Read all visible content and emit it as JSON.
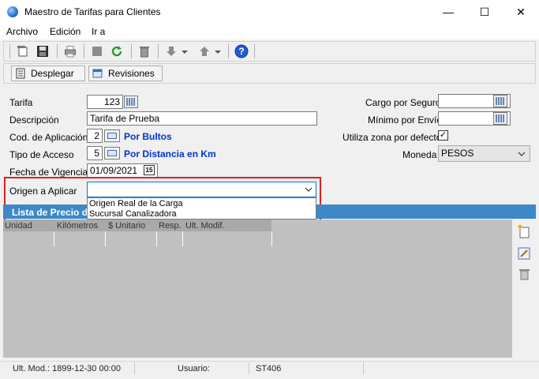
{
  "window": {
    "title": "Maestro de Tarifas para Clientes",
    "minimize": "—",
    "maximize": "☐",
    "close": "✕"
  },
  "menu": [
    "Archivo",
    "Edición",
    "Ir a"
  ],
  "buttons": {
    "desplegar": "Desplegar",
    "revisiones": "Revisiones"
  },
  "form": {
    "tarifa": {
      "label": "Tarifa",
      "value": "123"
    },
    "descripcion": {
      "label": "Descripción",
      "value": "Tarifa de Prueba"
    },
    "cod_aplicacion": {
      "label": "Cod. de Aplicación",
      "value": "2",
      "desc": "Por Bultos"
    },
    "tipo_acceso": {
      "label": "Tipo de Acceso",
      "value": "5",
      "desc": "Por Distancia en Km"
    },
    "fecha_vigencia": {
      "label": "Fecha de Vigencia",
      "value": "01/09/2021",
      "calendar_glyph": "15"
    },
    "origen": {
      "label": "Origen a Aplicar",
      "value": "",
      "options": [
        "Origen Real de la Carga",
        "Sucursal Canalizadora"
      ]
    },
    "cargo_seguro": {
      "label": "Cargo por Seguro",
      "value": ""
    },
    "minimo_envio": {
      "label": "Mínimo por Envío",
      "value": ""
    },
    "utiliza_zona": {
      "label": "Utiliza zona por defecto",
      "checked": true,
      "check_glyph": "✓"
    },
    "moneda": {
      "label": "Moneda",
      "value": "PESOS"
    }
  },
  "list": {
    "title": "Lista de Precio de",
    "columns": [
      "Unidad",
      "Kilómetros",
      "$ Unitario",
      "Resp.",
      "Ult. Modif."
    ]
  },
  "status": {
    "ult_mod": "Ult. Mod.: 1899-12-30 00:00",
    "usuario_label": "Usuario:",
    "usuario": "ST406"
  },
  "colors": {
    "accent": "#3d88c8",
    "highlight": "#e02020",
    "link_text": "#0033cc"
  }
}
